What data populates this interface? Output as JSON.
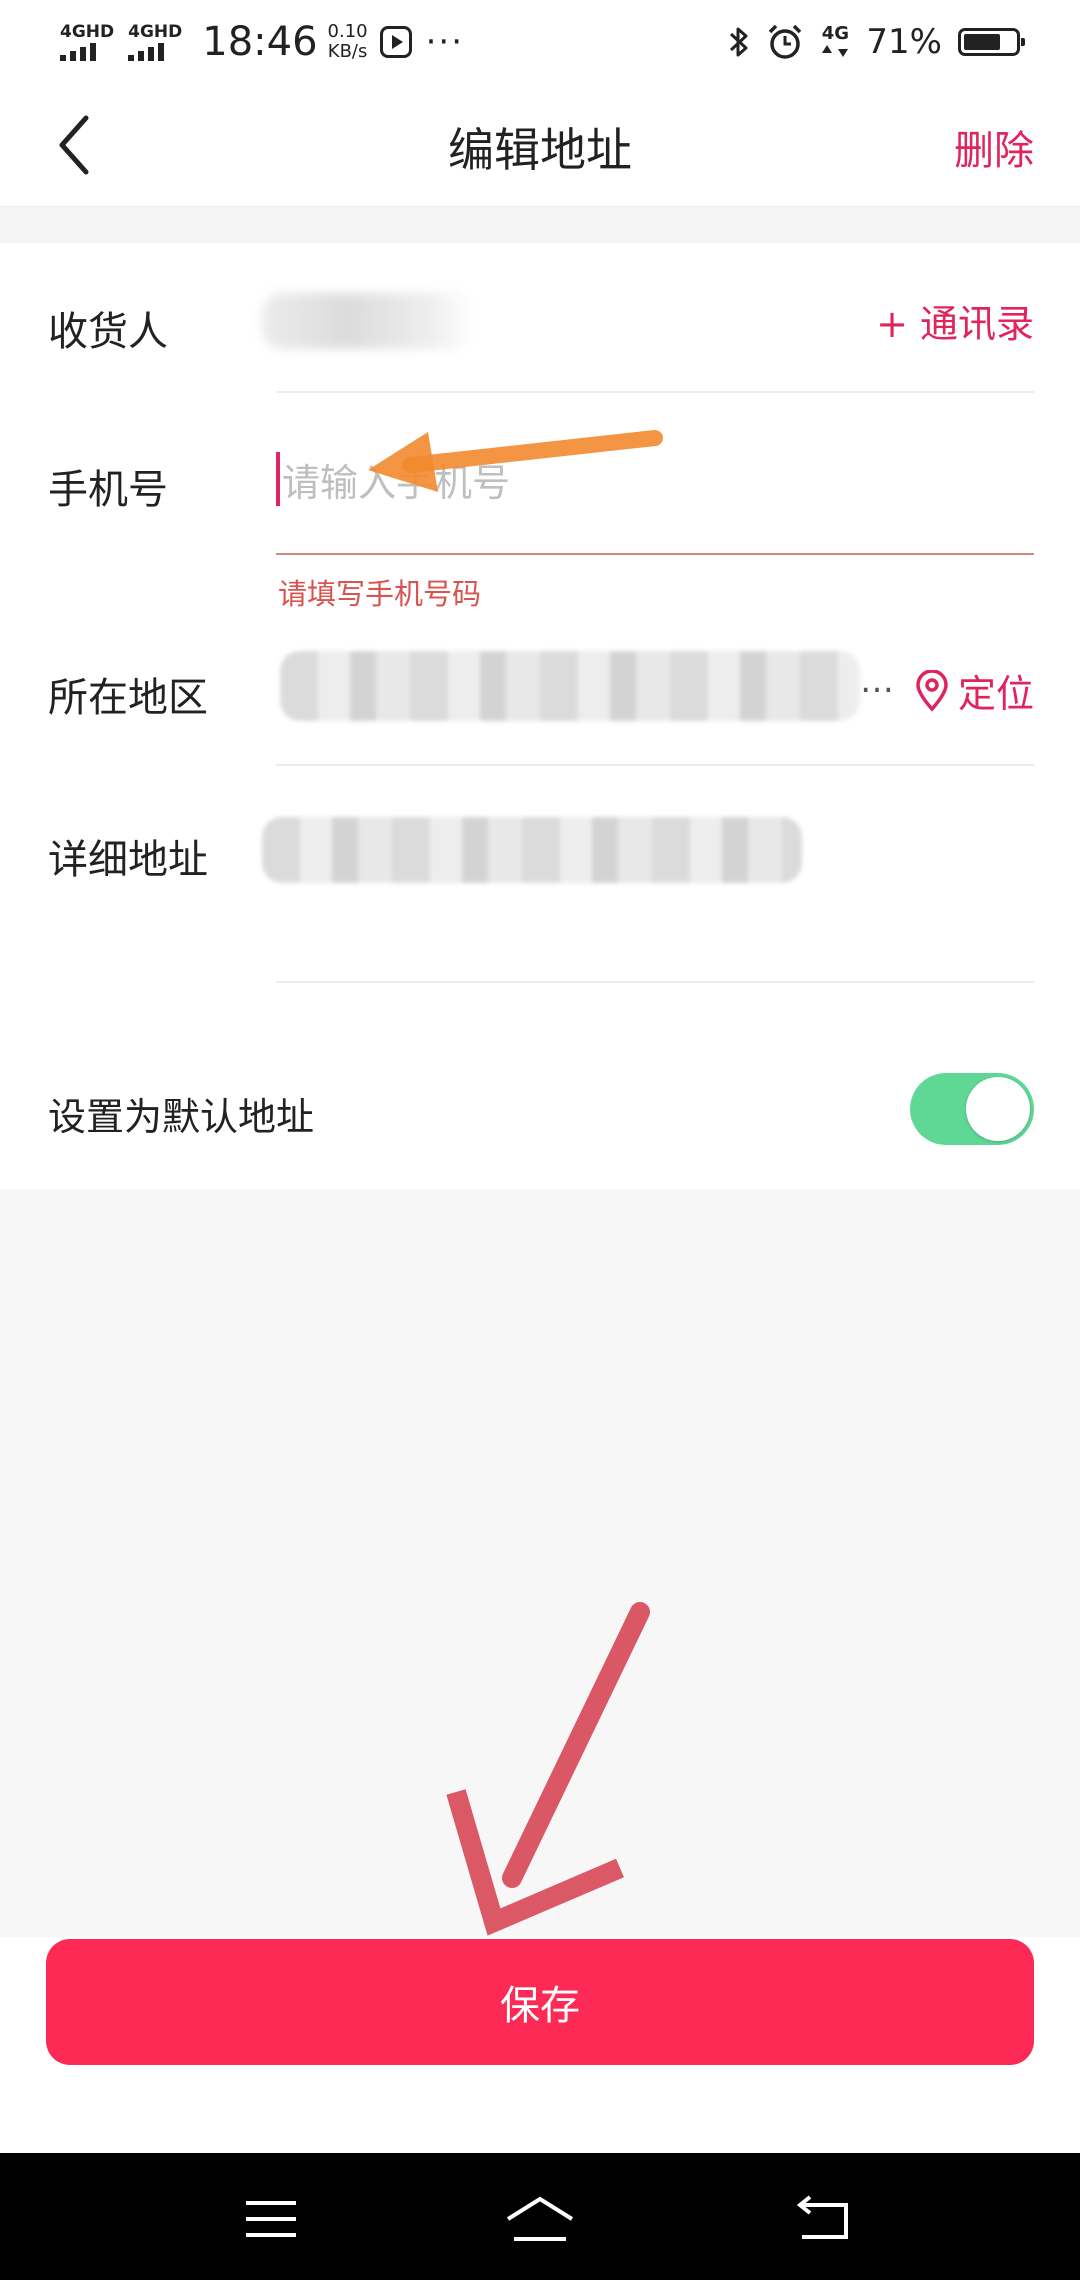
{
  "status_bar": {
    "net1": "4GHD",
    "net2": "4GHD",
    "time": "18:46",
    "speed_value": "0.10",
    "speed_unit": "KB/s",
    "dots": "···",
    "net3": "4G",
    "battery_pct": "71%",
    "battery_level": 0.71
  },
  "header": {
    "title": "编辑地址",
    "delete_label": "删除"
  },
  "form": {
    "receiver_label": "收货人",
    "contacts_label": "+ 通讯录",
    "phone_label": "手机号",
    "phone_placeholder": "请输入手机号",
    "phone_value": "",
    "phone_error": "请填写手机号码",
    "region_label": "所在地区",
    "region_ellipsis": "…",
    "locate_label": "定位",
    "address_label": "详细地址",
    "default_label": "设置为默认地址",
    "default_on": true
  },
  "actions": {
    "save_label": "保存"
  },
  "colors": {
    "accent": "#e0245e",
    "save_button": "#fe2a56",
    "toggle_on": "#5fd895",
    "annotation_orange": "#f28a2e",
    "annotation_red": "#d9505e"
  }
}
